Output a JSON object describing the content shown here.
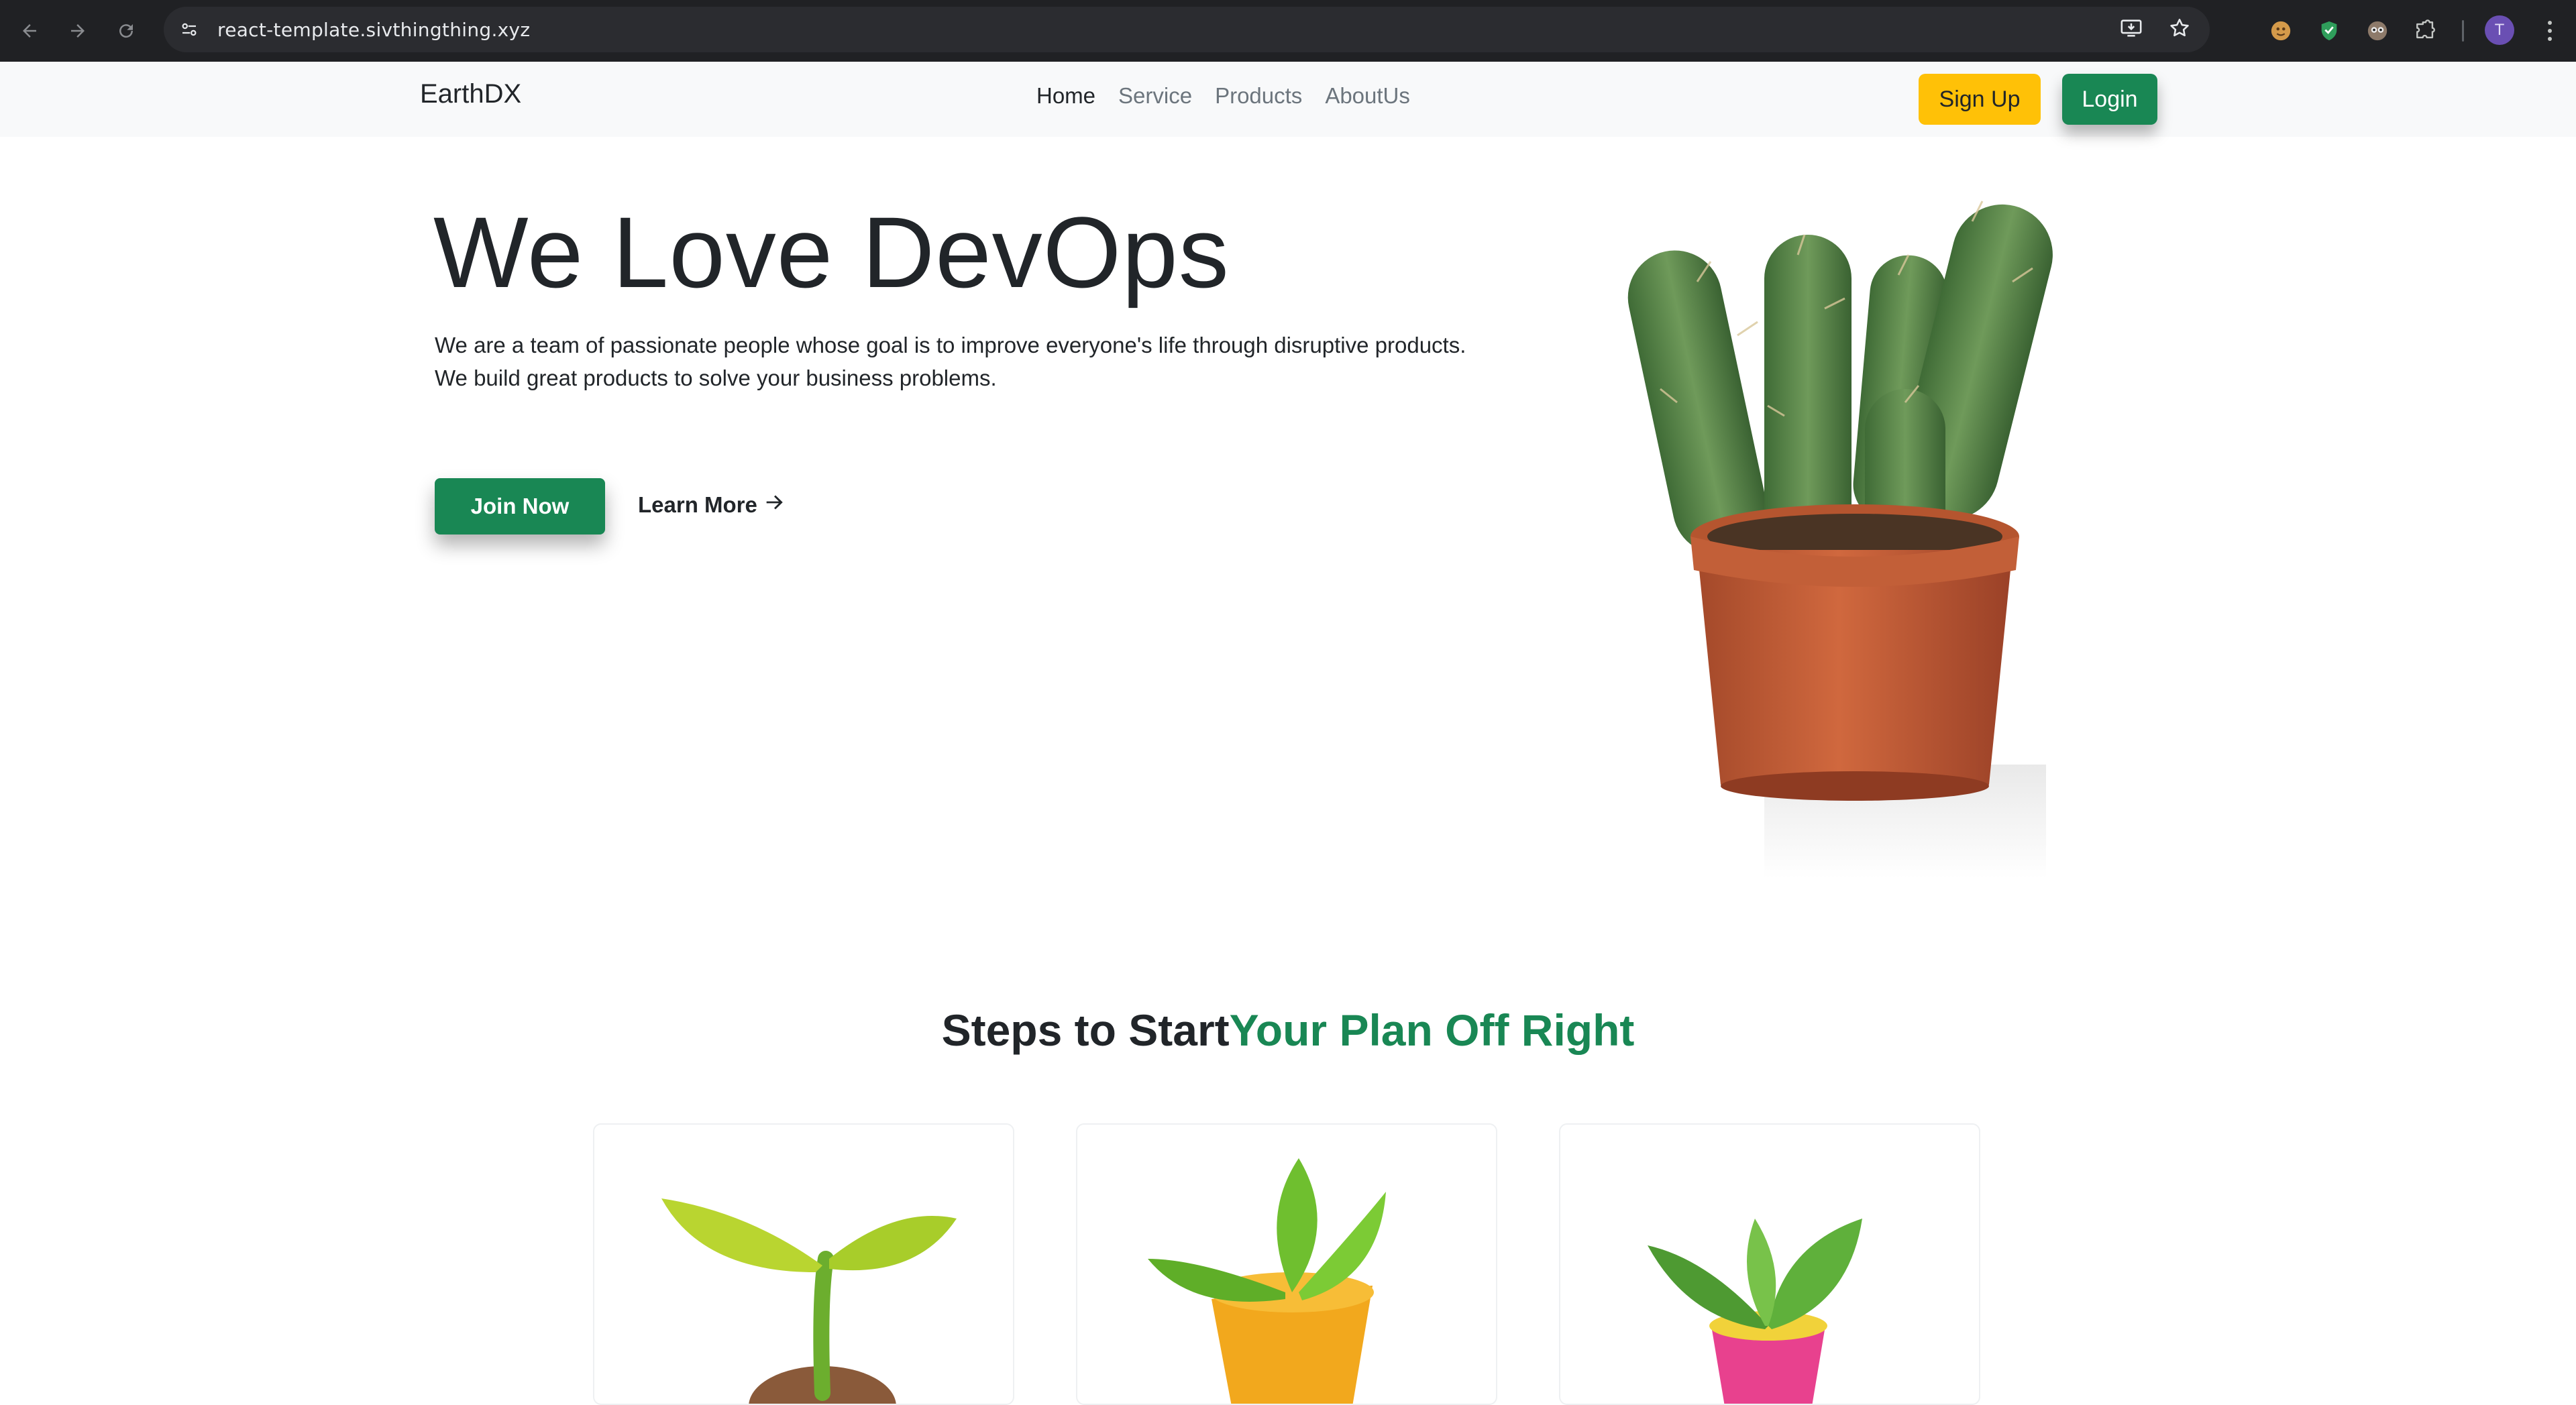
{
  "browser": {
    "url": "react-template.sivthingthing.xyz",
    "profile_initial": "T",
    "icons": [
      "back-arrow-icon",
      "forward-arrow-icon",
      "reload-icon",
      "site-settings-icon",
      "install-app-icon",
      "bookmark-star-icon",
      "extension-icon",
      "extensions-puzzle-icon",
      "menu-dots-icon"
    ]
  },
  "navbar": {
    "brand": "EarthDX",
    "links": [
      {
        "label": "Home",
        "active": true
      },
      {
        "label": "Service",
        "active": false
      },
      {
        "label": "Products",
        "active": false
      },
      {
        "label": "AboutUs",
        "active": false
      }
    ],
    "signup_label": "Sign Up",
    "login_label": "Login"
  },
  "hero": {
    "title": "We Love DevOps",
    "text_line1": "We are a team of passionate people whose goal is to improve everyone's life through disruptive products.",
    "text_line2": "We build great products to solve your business problems.",
    "join_label": "Join Now",
    "learn_more_label": "Learn More",
    "image": "cactus-in-pot"
  },
  "steps": {
    "title_part1": "Steps to Start",
    "title_part2": "Your Plan Off Right",
    "cards": [
      {
        "image": "sprout-seedling"
      },
      {
        "image": "yellow-pot-plant"
      },
      {
        "image": "pink-pot-plant"
      }
    ]
  },
  "colors": {
    "primary_green": "#198754",
    "warning_yellow": "#ffc107",
    "navbar_bg": "#f8f9fa",
    "chrome_bg": "#202124"
  }
}
